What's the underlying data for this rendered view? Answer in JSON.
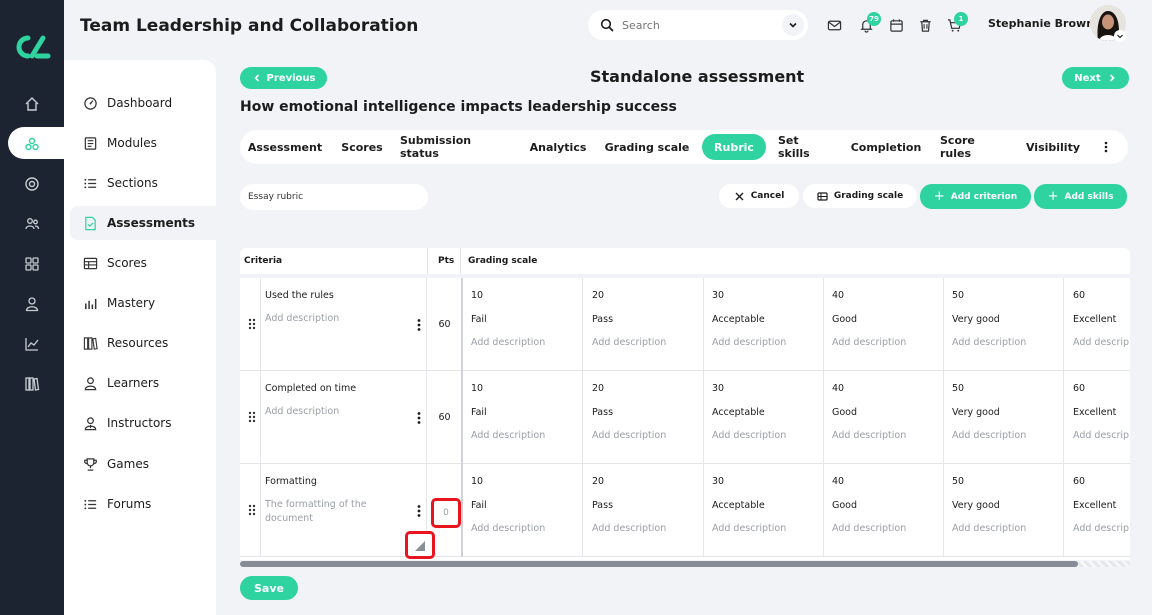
{
  "app": {
    "title": "Team Leadership and Collaboration",
    "search_placeholder": "Search",
    "notifications_count": "79",
    "cart_count": "1",
    "user_name": "Stephanie Brown",
    "accent_color": "#2ed3a0",
    "rail_color": "#1b2430"
  },
  "rail": {
    "icons": [
      "home-icon",
      "modules-icon",
      "target-icon",
      "people-icon",
      "grid-icon",
      "user-icon",
      "chart-icon",
      "library-icon"
    ]
  },
  "sidebar": {
    "items": [
      {
        "label": "Dashboard",
        "icon": "dashboard-icon"
      },
      {
        "label": "Modules",
        "icon": "modules-icon"
      },
      {
        "label": "Sections",
        "icon": "sections-icon"
      },
      {
        "label": "Assessments",
        "icon": "assessments-icon",
        "active": true
      },
      {
        "label": "Scores",
        "icon": "scores-icon"
      },
      {
        "label": "Mastery",
        "icon": "mastery-icon"
      },
      {
        "label": "Resources",
        "icon": "resources-icon"
      },
      {
        "label": "Learners",
        "icon": "learners-icon"
      },
      {
        "label": "Instructors",
        "icon": "instructors-icon"
      },
      {
        "label": "Games",
        "icon": "games-icon"
      },
      {
        "label": "Forums",
        "icon": "forums-icon"
      }
    ]
  },
  "page": {
    "prev_label": "Previous",
    "next_label": "Next",
    "title": "Standalone assessment",
    "subtitle": "How emotional intelligence impacts leadership success"
  },
  "tabs": [
    {
      "label": "Assessment"
    },
    {
      "label": "Scores"
    },
    {
      "label": "Submission status"
    },
    {
      "label": "Analytics"
    },
    {
      "label": "Grading scale"
    },
    {
      "label": "Rubric",
      "active": true
    },
    {
      "label": "Set skills"
    },
    {
      "label": "Completion"
    },
    {
      "label": "Score rules"
    },
    {
      "label": "Visibility"
    }
  ],
  "toolbar": {
    "rubric_name": "Essay rubric",
    "cancel_label": "Cancel",
    "grading_scale_label": "Grading scale",
    "add_criterion_label": "Add criterion",
    "add_skills_label": "Add skills"
  },
  "table": {
    "headers": {
      "criteria": "Criteria",
      "pts": "Pts",
      "grading_scale": "Grading scale"
    },
    "rows": [
      {
        "name": "Used the rules",
        "description": "Add description",
        "pts": "60",
        "cells": [
          {
            "pts": "10",
            "label": "Fail",
            "desc": "Add description"
          },
          {
            "pts": "20",
            "label": "Pass",
            "desc": "Add description"
          },
          {
            "pts": "30",
            "label": "Acceptable",
            "desc": "Add description"
          },
          {
            "pts": "40",
            "label": "Good",
            "desc": "Add description"
          },
          {
            "pts": "50",
            "label": "Very good",
            "desc": "Add description"
          },
          {
            "pts": "60",
            "label": "Excellent",
            "desc": "Add descrip"
          }
        ]
      },
      {
        "name": "Completed on time",
        "description": "Add description",
        "pts": "60",
        "cells": [
          {
            "pts": "10",
            "label": "Fail",
            "desc": "Add description"
          },
          {
            "pts": "20",
            "label": "Pass",
            "desc": "Add description"
          },
          {
            "pts": "30",
            "label": "Acceptable",
            "desc": "Add description"
          },
          {
            "pts": "40",
            "label": "Good",
            "desc": "Add description"
          },
          {
            "pts": "50",
            "label": "Very good",
            "desc": "Add description"
          },
          {
            "pts": "60",
            "label": "Excellent",
            "desc": "Add descrip"
          }
        ]
      },
      {
        "name": "Formatting",
        "description": "The formatting of the document",
        "pts": "0",
        "cells": [
          {
            "pts": "10",
            "label": "Fail",
            "desc": "Add description"
          },
          {
            "pts": "20",
            "label": "Pass",
            "desc": "Add description"
          },
          {
            "pts": "30",
            "label": "Acceptable",
            "desc": "Add description"
          },
          {
            "pts": "40",
            "label": "Good",
            "desc": "Add description"
          },
          {
            "pts": "50",
            "label": "Very good",
            "desc": "Add description"
          },
          {
            "pts": "60",
            "label": "Excellent",
            "desc": "Add descrip"
          }
        ]
      }
    ]
  },
  "footer": {
    "save_label": "Save"
  }
}
